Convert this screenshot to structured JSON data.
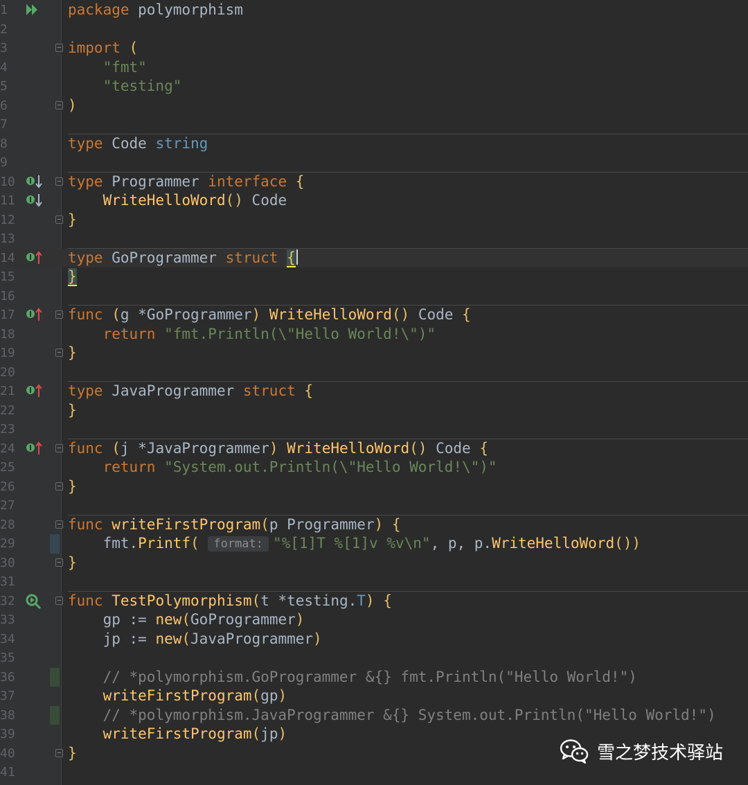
{
  "editor": {
    "language": "go",
    "theme_colors": {
      "background": "#2b2b2b",
      "keyword": "#cc7832",
      "string": "#6a8759",
      "type": "#6897bb",
      "function": "#ffc66d",
      "comment": "#808080",
      "run_icon": "#59a869",
      "impl_arrow_up": "#e04a4a",
      "vcs_changed": "#374752",
      "vcs_added": "#384c38"
    },
    "current_line": 14,
    "lines": [
      {
        "n": "1",
        "code": "package polymorphism",
        "gutter_icon": "run-icon"
      },
      {
        "n": "2",
        "code": ""
      },
      {
        "n": "3",
        "code": "import (",
        "fold": true
      },
      {
        "n": "4",
        "code": "    \"fmt\""
      },
      {
        "n": "5",
        "code": "    \"testing\""
      },
      {
        "n": "6",
        "code": ")",
        "fold": true
      },
      {
        "n": "7",
        "code": ""
      },
      {
        "n": "8",
        "code": "type Code string"
      },
      {
        "n": "9",
        "code": ""
      },
      {
        "n": "10",
        "code": "type Programmer interface {",
        "fold": true,
        "gutter_icon": "implemented-down-icon"
      },
      {
        "n": "11",
        "code": "    WriteHelloWord() Code",
        "gutter_icon": "implemented-down-icon"
      },
      {
        "n": "12",
        "code": "}",
        "fold": true
      },
      {
        "n": "13",
        "code": ""
      },
      {
        "n": "14",
        "code": "type GoProgrammer struct {",
        "gutter_icon": "implements-up-icon"
      },
      {
        "n": "15",
        "code": "}"
      },
      {
        "n": "16",
        "code": ""
      },
      {
        "n": "17",
        "code": "func (g *GoProgrammer) WriteHelloWord() Code {",
        "fold": true,
        "gutter_icon": "implements-up-icon"
      },
      {
        "n": "18",
        "code": "    return \"fmt.Println(\\\"Hello World!\\\")\""
      },
      {
        "n": "19",
        "code": "}",
        "fold": true
      },
      {
        "n": "20",
        "code": ""
      },
      {
        "n": "21",
        "code": "type JavaProgrammer struct {",
        "gutter_icon": "implements-up-icon"
      },
      {
        "n": "22",
        "code": "}"
      },
      {
        "n": "23",
        "code": ""
      },
      {
        "n": "24",
        "code": "func (j *JavaProgrammer) WriteHelloWord() Code {",
        "fold": true,
        "gutter_icon": "implements-up-icon"
      },
      {
        "n": "25",
        "code": "    return \"System.out.Println(\\\"Hello World!\\\")\""
      },
      {
        "n": "26",
        "code": "}",
        "fold": true
      },
      {
        "n": "27",
        "code": ""
      },
      {
        "n": "28",
        "code": "func writeFirstProgram(p Programmer) {",
        "fold": true
      },
      {
        "n": "29",
        "code": "    fmt.Printf( format: \"%[1]T %[1]v %v\\n\", p, p.WriteHelloWord())",
        "vcs": "changed"
      },
      {
        "n": "30",
        "code": "}",
        "fold": true
      },
      {
        "n": "31",
        "code": ""
      },
      {
        "n": "32",
        "code": "func TestPolymorphism(t *testing.T) {",
        "fold": true,
        "gutter_icon": "run-test-icon"
      },
      {
        "n": "33",
        "code": "    gp := new(GoProgrammer)"
      },
      {
        "n": "34",
        "code": "    jp := new(JavaProgrammer)"
      },
      {
        "n": "35",
        "code": ""
      },
      {
        "n": "36",
        "code": "    // *polymorphism.GoProgrammer &{} fmt.Println(\"Hello World!\")",
        "vcs": "added"
      },
      {
        "n": "37",
        "code": "    writeFirstProgram(gp)"
      },
      {
        "n": "38",
        "code": "    // *polymorphism.JavaProgrammer &{} System.out.Println(\"Hello World!\")",
        "vcs": "added"
      },
      {
        "n": "39",
        "code": "    writeFirstProgram(jp)"
      },
      {
        "n": "40",
        "code": "}",
        "fold": true
      },
      {
        "n": "41",
        "code": ""
      }
    ],
    "parameter_hint": "format:"
  },
  "watermark": {
    "text": "雪之梦技术驿站",
    "icon": "wechat-icon"
  }
}
